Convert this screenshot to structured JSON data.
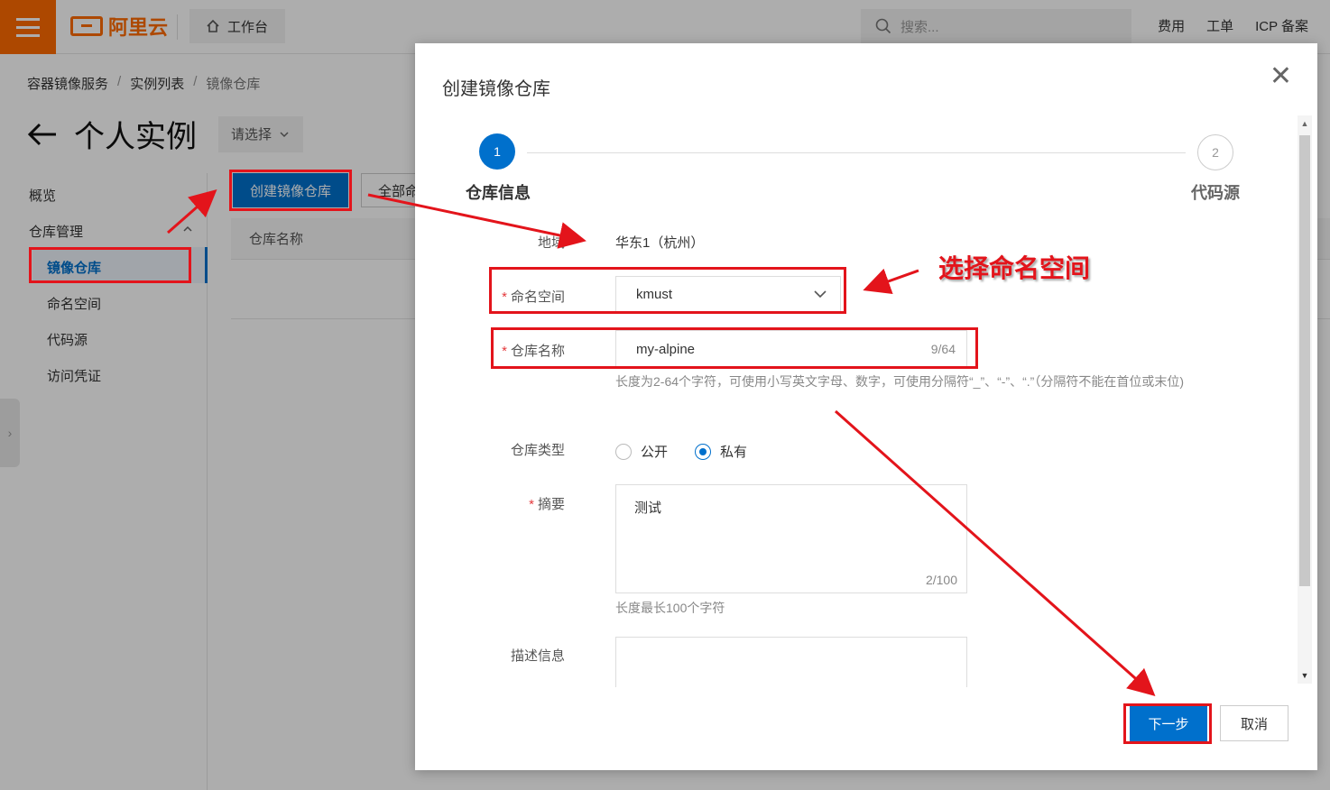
{
  "topbar": {
    "brand": "阿里云",
    "workbench": "工作台",
    "search_placeholder": "搜索...",
    "links": [
      "费用",
      "工单",
      "ICP 备案"
    ]
  },
  "breadcrumb": [
    "容器镜像服务",
    "实例列表",
    "镜像仓库"
  ],
  "page": {
    "title": "个人实例",
    "instance_select": "请选择"
  },
  "nav": {
    "overview": "概览",
    "repo_mgmt": "仓库管理",
    "image_repo": "镜像仓库",
    "namespace": "命名空间",
    "code_source": "代码源",
    "access_credential": "访问凭证"
  },
  "content": {
    "create_button": "创建镜像仓库",
    "all_namespaces": "全部命",
    "table_col_repo_name": "仓库名称"
  },
  "dialog": {
    "title": "创建镜像仓库",
    "steps": [
      {
        "num": "1",
        "label": "仓库信息"
      },
      {
        "num": "2",
        "label": "代码源"
      }
    ],
    "region_label": "地域",
    "region_value": "华东1（杭州）",
    "namespace_label": "命名空间",
    "namespace_value": "kmust",
    "repo_name_label": "仓库名称",
    "repo_name_value": "my-alpine",
    "repo_name_count": "9/64",
    "repo_name_hint": "长度为2-64个字符，可使用小写英文字母、数字，可使用分隔符“_”、“-”、“.”（分隔符不能在首位或末位)",
    "repo_type_label": "仓库类型",
    "repo_type_options": [
      "公开",
      "私有"
    ],
    "repo_type_selected": "私有",
    "summary_label": "摘要",
    "summary_value": "测试",
    "summary_count": "2/100",
    "summary_hint": "长度最长100个字符",
    "description_label": "描述信息",
    "next_button": "下一步",
    "cancel_button": "取消"
  },
  "annotation": {
    "callout": "选择命名空间",
    "color": "#e3141b"
  },
  "colors": {
    "brand": "#ff6a00",
    "primary": "#0070cc"
  }
}
